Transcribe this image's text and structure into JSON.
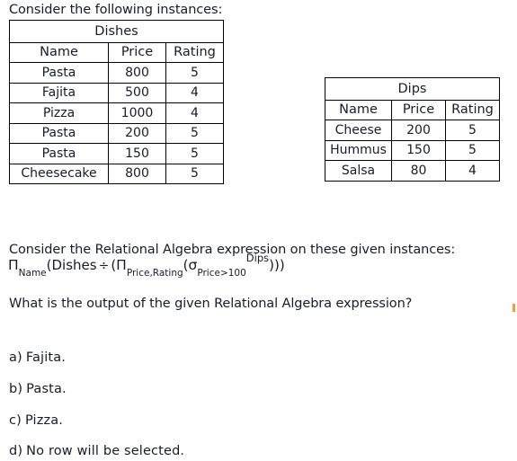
{
  "intro": {
    "text": "Consider the following instances:"
  },
  "tables": [
    {
      "id": "dishes",
      "caption": "Dishes",
      "columns": [
        "Name",
        "Price",
        "Rating"
      ],
      "rows": [
        [
          "Pasta",
          "800",
          "5"
        ],
        [
          "Fajita",
          "500",
          "4"
        ],
        [
          "Pizza",
          "1000",
          "4"
        ],
        [
          "Pasta",
          "200",
          "5"
        ],
        [
          "Pasta",
          "150",
          "5"
        ],
        [
          "Cheesecake",
          "800",
          "5"
        ]
      ]
    },
    {
      "id": "dips",
      "caption": "Dips",
      "columns": [
        "Name",
        "Price",
        "Rating"
      ],
      "rows": [
        [
          "Cheese",
          "200",
          "5"
        ],
        [
          "Hummus",
          "150",
          "5"
        ],
        [
          "Salsa",
          "80",
          "4"
        ]
      ]
    }
  ],
  "ra_intro": {
    "text": "Consider the Relational Algebra expression on these given instances:"
  },
  "formula": {
    "pi1": "Π",
    "pi1_sub": "Name",
    "open1": "(Dishes",
    "divide": "÷",
    "open2": "(",
    "pi2": "Π",
    "pi2_sub": "Price,Rating",
    "open3": "(",
    "sigma": "σ",
    "sigma_sub": "Price>100",
    "relation": "Dips",
    "close": ")))",
    "plain": "ΠName(Dishes ÷ (ΠPrice,Rating(σPrice>100Dips)))"
  },
  "question": {
    "text": "What is the output of the given Relational Algebra expression?"
  },
  "options": [
    {
      "label": "a)",
      "text": "Fajita."
    },
    {
      "label": "b)",
      "text": "Pasta."
    },
    {
      "label": "c)",
      "text": "Pizza."
    },
    {
      "label": "d)",
      "text": "No row  will  be  selected."
    }
  ],
  "colors": {
    "text": "#1a1a2e",
    "border": "#000000",
    "background": "#ffffff",
    "edge_mark": "#e8a33d"
  }
}
